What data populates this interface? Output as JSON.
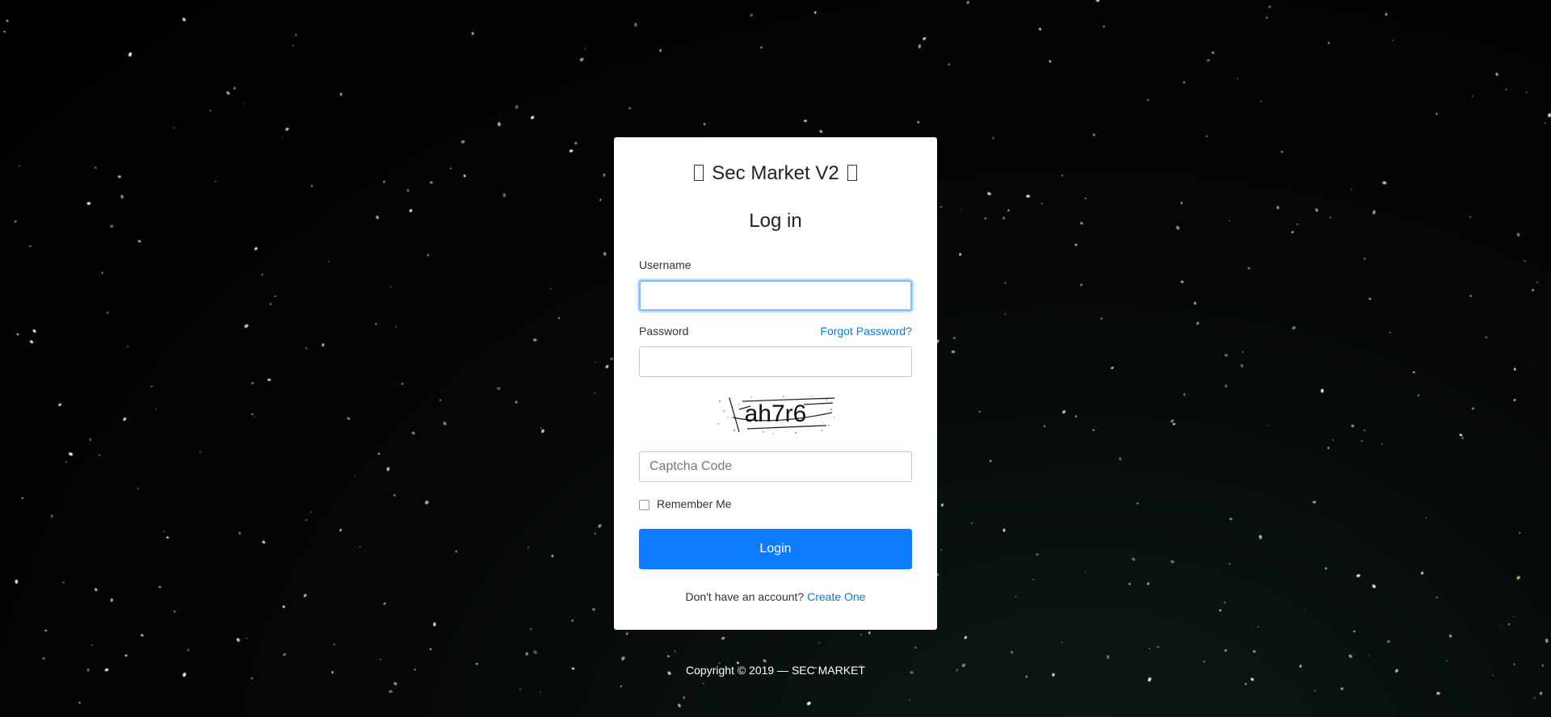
{
  "brand": {
    "title": "Sec Market V2",
    "left_icon": "missing-glyph-icon",
    "right_icon": "missing-glyph-icon"
  },
  "form": {
    "heading": "Log in",
    "username_label": "Username",
    "username_value": "",
    "password_label": "Password",
    "forgot_label": "Forgot Password?",
    "password_value": "",
    "captcha_text": "ah7r6",
    "captcha_placeholder": "Captcha Code",
    "remember_label": "Remember Me",
    "remember_checked": false,
    "login_label": "Login",
    "no_account_text": "Don't have an account?",
    "create_label": "Create One"
  },
  "footer": {
    "copyright": "Copyright © 2019 — SEC MARKET"
  },
  "colors": {
    "primary": "#0b7bff",
    "link": "#0b7ccf",
    "focus_ring": "#80bdff",
    "background": "#000000",
    "card": "#ffffff"
  }
}
